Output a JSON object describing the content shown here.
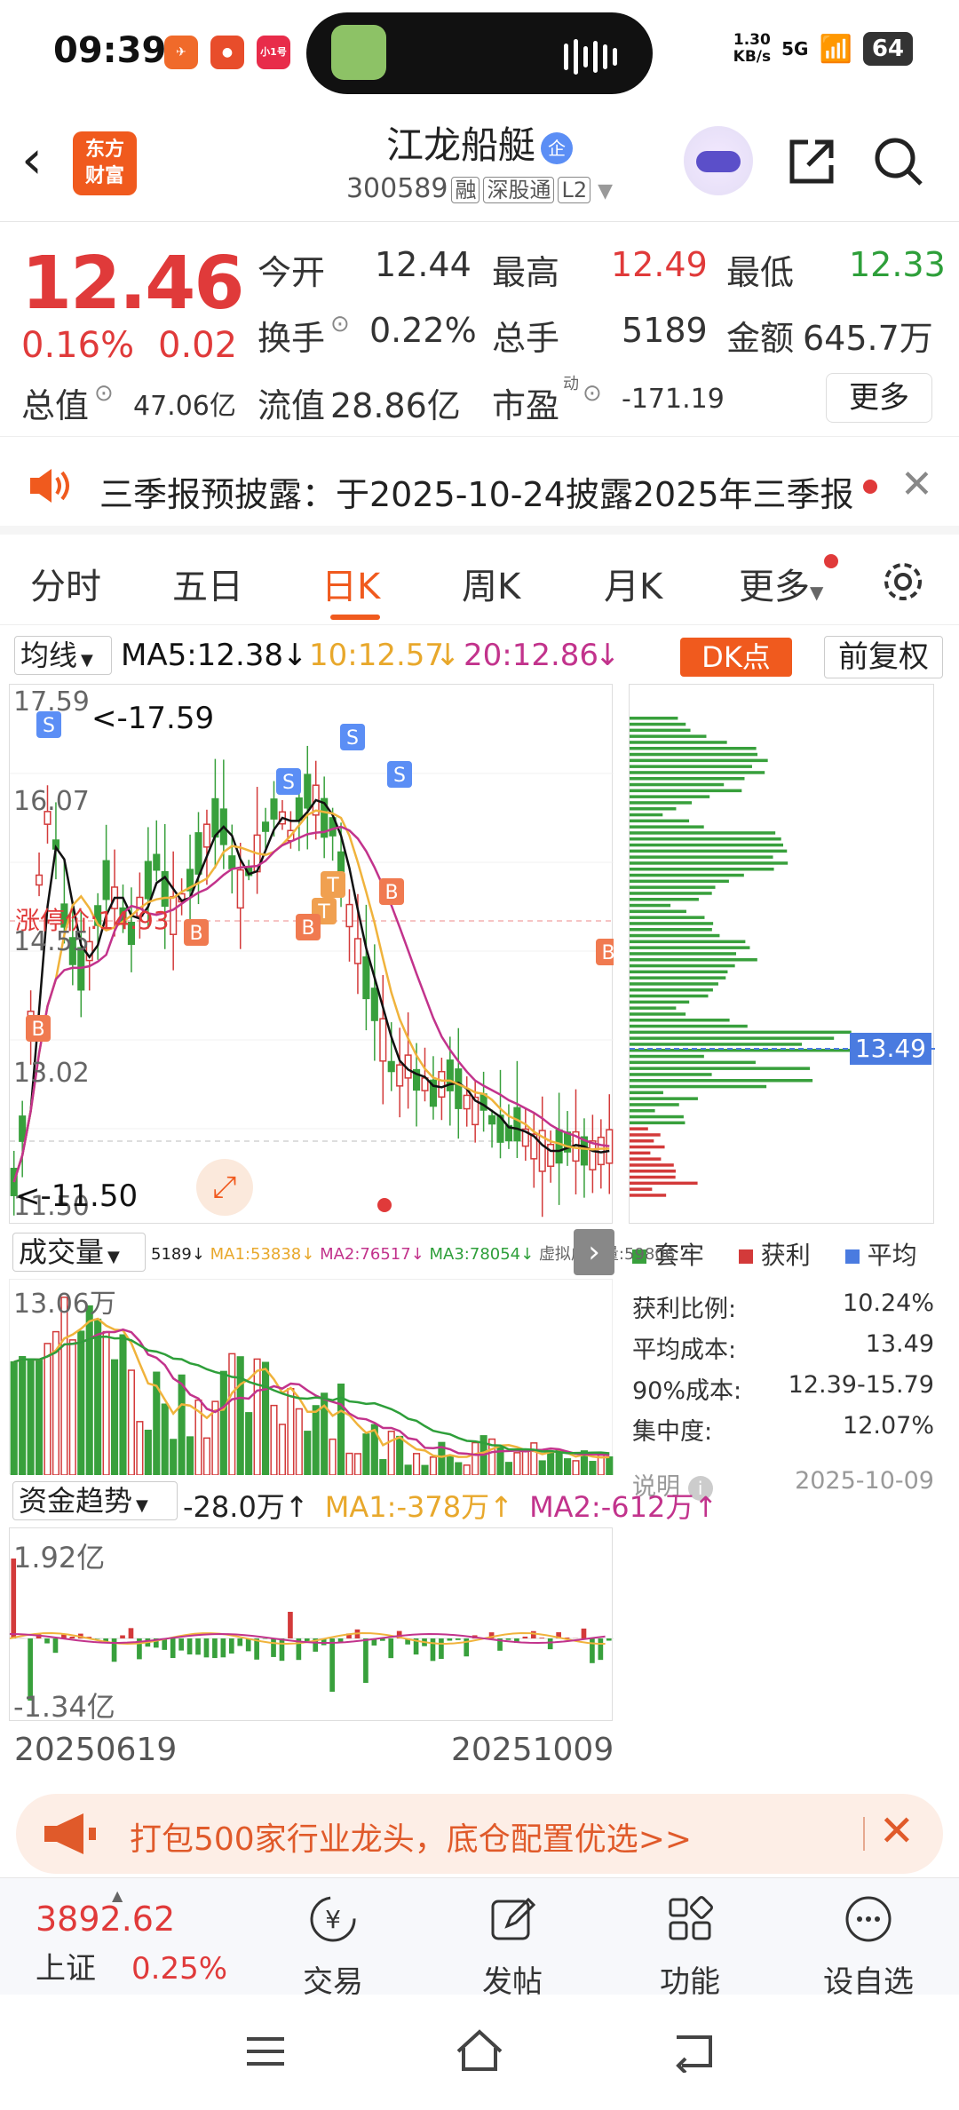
{
  "status_bar": {
    "time": "09:39",
    "app_badge": "小1号",
    "net_speed_top": "1.30",
    "net_speed_bottom": "KB/s",
    "signal": "5G",
    "battery": "64"
  },
  "header": {
    "logo_line1": "东方",
    "logo_line2": "财富",
    "stock_name": "江龙船艇",
    "enterprise_badge": "企",
    "stock_code": "300589",
    "tag_margin": "融",
    "tag_connect": "深股通",
    "tag_level": "L2"
  },
  "quote": {
    "price": "12.46",
    "change_pct": "0.16%",
    "change_amt": "0.02",
    "open_label": "今开",
    "open": "12.44",
    "high_label": "最高",
    "high": "12.49",
    "low_label": "最低",
    "low": "12.33",
    "turnover_label": "换手",
    "turnover": "0.22%",
    "volume_label": "总手",
    "volume": "5189",
    "amount_label": "金额",
    "amount": "645.7万",
    "mktcap_label": "总值",
    "mktcap": "47.06亿",
    "float_label": "流值",
    "float_cap": "28.86亿",
    "pe_label": "市盈",
    "pe_sup": "动",
    "pe": "-171.19",
    "more_button": "更多"
  },
  "notice": {
    "text": "三季报预披露：于2025-10-24披露2025年三季报"
  },
  "tabs": [
    "分时",
    "五日",
    "日K",
    "周K",
    "月K",
    "更多"
  ],
  "active_tab": "日K",
  "ma_bar": {
    "selector": "均线",
    "ma5": "MA5:12.38",
    "ma10": "10:12.57",
    "ma20": "20:12.86",
    "dk_button": "DK点",
    "adjust_button": "前复权"
  },
  "kline": {
    "y_labels": [
      "17.59",
      "16.07",
      "14.55",
      "13.02",
      "11.50"
    ],
    "max_label": "<-17.59",
    "min_label": "<-11.50",
    "avg_cost_label": "涨停价:14.93",
    "profile_price": "13.49",
    "colors": {
      "up": "#d33a3a",
      "down": "#38a03c",
      "ma5": "#111111",
      "ma10": "#f0b33c",
      "ma20": "#c2338c"
    }
  },
  "chip": {
    "legend_trapped": "套牢",
    "legend_profit": "获利",
    "legend_avg": "平均",
    "profit_ratio_label": "获利比例:",
    "profit_ratio": "10.24%",
    "avg_cost_label": "平均成本:",
    "avg_cost": "13.49",
    "cost90_label": "90%成本:",
    "cost90": "12.39-15.79",
    "concentration_label": "集中度:",
    "concentration": "12.07%",
    "explain": "说明",
    "date": "2025-10-09"
  },
  "volume": {
    "selector": "成交量",
    "info": "5189↓",
    "ma1": "MA1:53838↓",
    "ma2": "MA2:76517↓",
    "ma3": "MA3:78054↓",
    "virtual": "虚拟成交量:59806",
    "y_top": "13.06万"
  },
  "fund": {
    "selector": "资金趋势",
    "value": "-28.0万↑",
    "ma1": "MA1:-378万↑",
    "ma2": "MA2:-612万↑",
    "y_top": "1.92亿",
    "y_bottom": "-1.34亿",
    "date_start": "20250619",
    "date_end": "20251009"
  },
  "promo": {
    "text": "打包500家行业龙头，底仓配置优选>>"
  },
  "bottom_bar": {
    "index_value": "3892.62",
    "index_name": "上证",
    "index_pct": "0.25%",
    "trade": "交易",
    "post": "发帖",
    "func": "功能",
    "watch": "设自选"
  }
}
